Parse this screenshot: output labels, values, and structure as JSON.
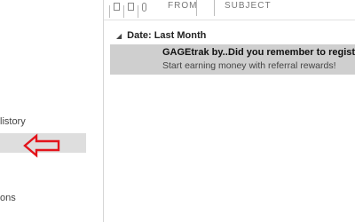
{
  "folder_pane": {
    "history_label": "listory",
    "bottom_label": "ons"
  },
  "message_list": {
    "columns": {
      "from": "FROM",
      "subject": "SUBJECT"
    },
    "group": {
      "label": "Date: Last Month"
    },
    "messages": [
      {
        "sender": "GAGEtrak by...",
        "subject": "Did you remember to register fo",
        "preview": "Start earning money with referral rewards!"
      }
    ]
  },
  "colors": {
    "selected_row": "#cfcfcf",
    "selected_folder": "#dedede",
    "annotation_arrow": "#e3141b"
  },
  "icons": {
    "annotation": "red-arrow-pointing-left",
    "group_toggle": "collapse-triangle-icon"
  }
}
